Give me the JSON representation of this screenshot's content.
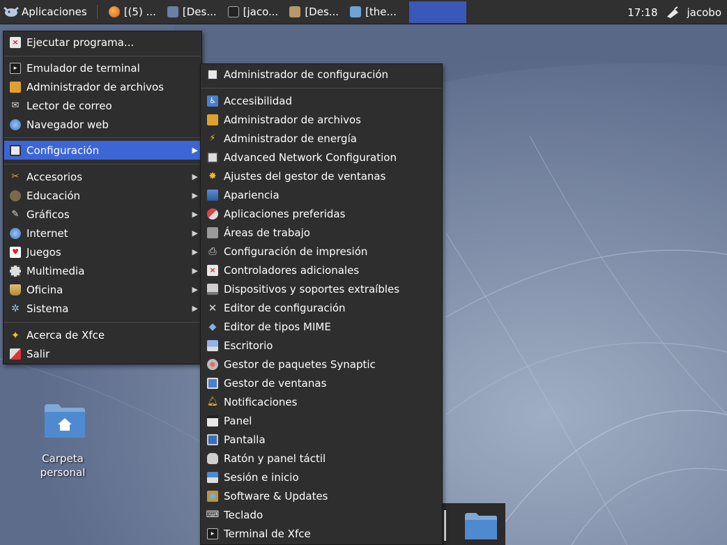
{
  "panel": {
    "apps_label": "Aplicaciones",
    "tasks": [
      {
        "label": "[(5) ...",
        "icon": "firefox-icon",
        "color": "#e07a2b"
      },
      {
        "label": "[Des...",
        "icon": "text-editor-icon",
        "color": "#6c7fa6"
      },
      {
        "label": "[jaco...",
        "icon": "terminal-icon",
        "color": "#9a9a9a"
      },
      {
        "label": "[Des...",
        "icon": "folder-icon",
        "color": "#c2a070"
      },
      {
        "label": "[the...",
        "icon": "folder-icon",
        "color": "#6fa3d6"
      }
    ],
    "clock": "17:18",
    "user": "jacobo"
  },
  "main_menu": {
    "items": [
      {
        "label": "Ejecutar programa...",
        "icon": "run-program-icon"
      },
      {
        "label": "Emulador de terminal",
        "icon": "terminal-icon"
      },
      {
        "label": "Administrador de archivos",
        "icon": "file-manager-icon"
      },
      {
        "label": "Lector de correo",
        "icon": "mail-reader-icon"
      },
      {
        "label": "Navegador web",
        "icon": "web-browser-icon"
      },
      {
        "label": "Configuración",
        "icon": "settings-icon"
      },
      {
        "label": "Accesorios",
        "icon": "accessories-icon"
      },
      {
        "label": "Educación",
        "icon": "education-icon"
      },
      {
        "label": "Gráficos",
        "icon": "graphics-icon"
      },
      {
        "label": "Internet",
        "icon": "internet-icon"
      },
      {
        "label": "Juegos",
        "icon": "games-icon"
      },
      {
        "label": "Multimedia",
        "icon": "multimedia-icon"
      },
      {
        "label": "Oficina",
        "icon": "office-icon"
      },
      {
        "label": "Sistema",
        "icon": "system-icon"
      },
      {
        "label": "Acerca de Xfce",
        "icon": "about-xfce-icon"
      },
      {
        "label": "Salir",
        "icon": "logout-icon"
      }
    ]
  },
  "sub_menu": {
    "items": [
      {
        "label": "Administrador de configuración",
        "icon": "settings-manager-icon"
      },
      {
        "label": "Accesibilidad",
        "icon": "accessibility-icon"
      },
      {
        "label": "Administrador de archivos",
        "icon": "file-manager-icon"
      },
      {
        "label": "Administrador de energía",
        "icon": "power-manager-icon"
      },
      {
        "label": "Advanced Network Configuration",
        "icon": "network-config-icon"
      },
      {
        "label": "Ajustes del gestor de ventanas",
        "icon": "window-tweaks-icon"
      },
      {
        "label": "Apariencia",
        "icon": "appearance-icon"
      },
      {
        "label": "Aplicaciones preferidas",
        "icon": "preferred-apps-icon"
      },
      {
        "label": "Áreas de trabajo",
        "icon": "workspaces-icon"
      },
      {
        "label": "Configuración de impresión",
        "icon": "printer-icon"
      },
      {
        "label": "Controladores adicionales",
        "icon": "drivers-icon"
      },
      {
        "label": "Dispositivos y soportes extraíbles",
        "icon": "removable-drives-icon"
      },
      {
        "label": "Editor de configuración",
        "icon": "config-editor-icon"
      },
      {
        "label": "Editor de tipos MIME",
        "icon": "mime-editor-icon"
      },
      {
        "label": "Escritorio",
        "icon": "desktop-icon"
      },
      {
        "label": "Gestor de paquetes Synaptic",
        "icon": "synaptic-icon"
      },
      {
        "label": "Gestor de ventanas",
        "icon": "window-manager-icon"
      },
      {
        "label": "Notificaciones",
        "icon": "bell-icon"
      },
      {
        "label": "Panel",
        "icon": "panel-icon"
      },
      {
        "label": "Pantalla",
        "icon": "display-icon"
      },
      {
        "label": "Ratón y panel táctil",
        "icon": "mouse-icon"
      },
      {
        "label": "Sesión e inicio",
        "icon": "session-icon"
      },
      {
        "label": "Software & Updates",
        "icon": "software-updates-icon"
      },
      {
        "label": "Teclado",
        "icon": "keyboard-icon"
      },
      {
        "label": "Terminal de Xfce",
        "icon": "terminal-icon"
      }
    ]
  },
  "desktop": {
    "home_label_line1": "Carpeta",
    "home_label_line2": "personal"
  },
  "colors": {
    "panel_bg": "#303030",
    "menu_bg": "#2e2e2e",
    "highlight": "#3c66d6"
  }
}
